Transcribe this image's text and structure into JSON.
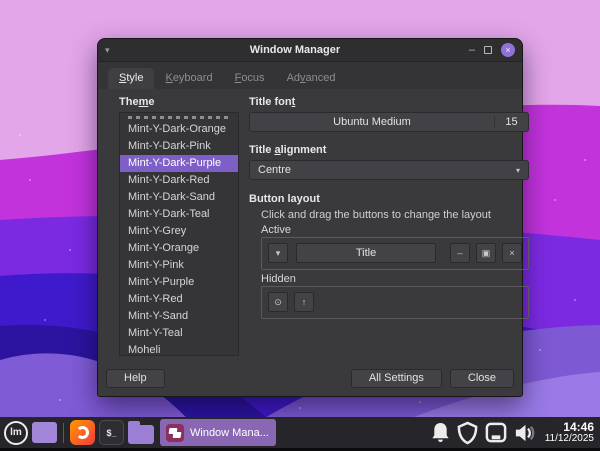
{
  "colors": {
    "accent_selection": "#7d5fc7",
    "close_button": "#8f72d8",
    "task_button": "#8a67b3",
    "wallpaper_top": "#e3a6e9",
    "wallpaper_magenta": "#c233dc",
    "wallpaper_violet": "#7b2ae2",
    "wallpaper_deep": "#3f1acc"
  },
  "window": {
    "title": "Window Manager",
    "controls": {
      "menu": "▾",
      "minimize": "–",
      "close": "×"
    },
    "tabs": [
      {
        "pre": "",
        "mn": "S",
        "post": "tyle"
      },
      {
        "pre": "",
        "mn": "K",
        "post": "eyboard"
      },
      {
        "pre": "",
        "mn": "F",
        "post": "ocus"
      },
      {
        "pre": "Ad",
        "mn": "v",
        "post": "anced"
      }
    ],
    "style": {
      "theme_label": {
        "pre": "The",
        "mn": "m",
        "post": "e"
      },
      "themes": [
        "Mint-Y-Dark-Orange",
        "Mint-Y-Dark-Pink",
        "Mint-Y-Dark-Purple",
        "Mint-Y-Dark-Red",
        "Mint-Y-Dark-Sand",
        "Mint-Y-Dark-Teal",
        "Mint-Y-Grey",
        "Mint-Y-Orange",
        "Mint-Y-Pink",
        "Mint-Y-Purple",
        "Mint-Y-Red",
        "Mint-Y-Sand",
        "Mint-Y-Teal",
        "Moheli"
      ],
      "selected_theme": "Mint-Y-Dark-Purple",
      "title_font_label": {
        "pre": "Title fon",
        "mn": "t",
        "post": ""
      },
      "font_button": {
        "name": "Ubuntu Medium",
        "size": "15"
      },
      "title_alignment_label": {
        "pre": "Title ",
        "mn": "a",
        "post": "lignment"
      },
      "alignment_value": "Centre",
      "combo_arrow": "▾",
      "button_layout_label": "Button layout",
      "button_layout_hint": "Click and drag the buttons to change the layout",
      "active_label": "Active",
      "active_row": {
        "menu": "▾",
        "title": "Title",
        "minimize": "–",
        "maximize": "▣",
        "close": "×"
      },
      "hidden_label": "Hidden",
      "hidden_row": {
        "stick": "⊙",
        "shade": "↑"
      }
    },
    "footer": {
      "help": "Help",
      "all_settings": "All Settings",
      "close": "Close"
    }
  },
  "taskbar": {
    "mint_menu_text": "lm",
    "terminal_icon_text": "$_",
    "task_button_label": "Window Mana...",
    "tray_icons": [
      "bell-icon",
      "shield-icon",
      "screen-icon",
      "volume-icon"
    ],
    "clock": {
      "time": "14:46",
      "date": "11/12/2025"
    }
  }
}
